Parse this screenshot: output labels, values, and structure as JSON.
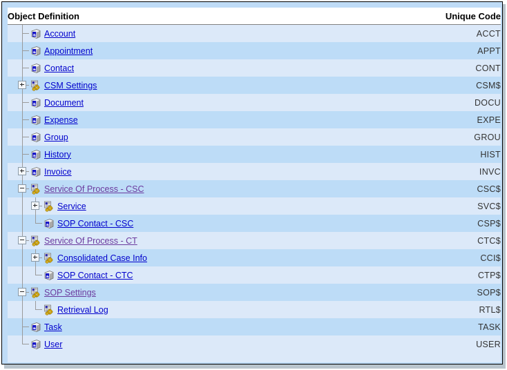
{
  "window": {
    "frame_border_color": "#000000",
    "shadow_color": "#b9c4cc",
    "page_background": "#bfdcf7",
    "row_color_even": "#dce9f9",
    "row_color_odd": "#bddcf7",
    "link_color": "#0000cc",
    "visited_link_color": "#6b3a9e"
  },
  "header": {
    "object_definition": "Object Definition",
    "unique_code": "Unique Code"
  },
  "tree": {
    "rows": [
      {
        "label": "Account",
        "code": "ACCT",
        "depth": 0,
        "toggle": "none",
        "icon": "object-icon",
        "visited": false,
        "last": false
      },
      {
        "label": "Appointment",
        "code": "APPT",
        "depth": 0,
        "toggle": "none",
        "icon": "object-icon",
        "visited": false,
        "last": false
      },
      {
        "label": "Contact",
        "code": "CONT",
        "depth": 0,
        "toggle": "none",
        "icon": "object-icon",
        "visited": false,
        "last": false
      },
      {
        "label": "CSM Settings",
        "code": "CSM$",
        "depth": 0,
        "toggle": "plus",
        "icon": "settings-icon",
        "visited": false,
        "last": false
      },
      {
        "label": "Document",
        "code": "DOCU",
        "depth": 0,
        "toggle": "none",
        "icon": "object-icon",
        "visited": false,
        "last": false
      },
      {
        "label": "Expense",
        "code": "EXPE",
        "depth": 0,
        "toggle": "none",
        "icon": "object-icon",
        "visited": false,
        "last": false
      },
      {
        "label": "Group",
        "code": "GROU",
        "depth": 0,
        "toggle": "none",
        "icon": "object-icon",
        "visited": false,
        "last": false
      },
      {
        "label": "History",
        "code": "HIST",
        "depth": 0,
        "toggle": "none",
        "icon": "object-icon",
        "visited": false,
        "last": false
      },
      {
        "label": "Invoice",
        "code": "INVC",
        "depth": 0,
        "toggle": "plus",
        "icon": "object-icon",
        "visited": false,
        "last": false
      },
      {
        "label": "Service Of Process - CSC",
        "code": "CSC$",
        "depth": 0,
        "toggle": "minus",
        "icon": "settings-icon",
        "visited": true,
        "last": false
      },
      {
        "label": "Service",
        "code": "SVC$",
        "depth": 1,
        "toggle": "plus",
        "icon": "settings-icon",
        "visited": false,
        "last": false
      },
      {
        "label": "SOP Contact - CSC",
        "code": "CSP$",
        "depth": 1,
        "toggle": "none",
        "icon": "object-icon",
        "visited": false,
        "last": true
      },
      {
        "label": "Service Of Process - CT",
        "code": "CTC$",
        "depth": 0,
        "toggle": "minus",
        "icon": "settings-icon",
        "visited": true,
        "last": false
      },
      {
        "label": "Consolidated Case Info",
        "code": "CCI$",
        "depth": 1,
        "toggle": "plus",
        "icon": "settings-icon",
        "visited": false,
        "last": false
      },
      {
        "label": "SOP Contact - CTC",
        "code": "CTP$",
        "depth": 1,
        "toggle": "none",
        "icon": "object-icon",
        "visited": false,
        "last": true
      },
      {
        "label": "SOP Settings",
        "code": "SOP$",
        "depth": 0,
        "toggle": "minus",
        "icon": "settings-icon",
        "visited": true,
        "last": false
      },
      {
        "label": "Retrieval Log",
        "code": "RTL$",
        "depth": 1,
        "toggle": "none",
        "icon": "settings-icon",
        "visited": false,
        "last": true
      },
      {
        "label": "Task",
        "code": "TASK",
        "depth": 0,
        "toggle": "none",
        "icon": "object-icon",
        "visited": false,
        "last": false
      },
      {
        "label": "User",
        "code": "USER",
        "depth": 0,
        "toggle": "none",
        "icon": "object-icon",
        "visited": false,
        "last": true
      }
    ]
  }
}
